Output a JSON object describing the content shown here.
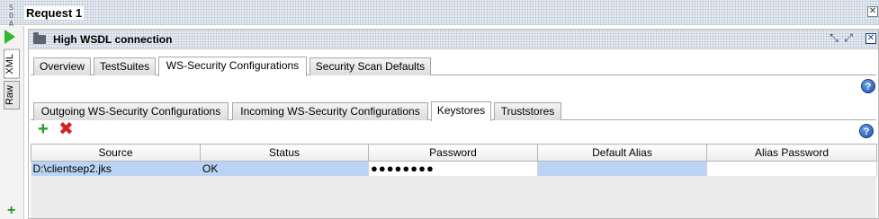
{
  "window": {
    "title": "Request 1",
    "soap_icon_text": "S O\nA P"
  },
  "left_strip": {
    "tabs": [
      {
        "label": "XML"
      },
      {
        "label": "Raw"
      }
    ]
  },
  "panel": {
    "title": "High WSDL connection"
  },
  "top_tabs": [
    {
      "label": "Overview"
    },
    {
      "label": "TestSuites"
    },
    {
      "label": "WS-Security Configurations"
    },
    {
      "label": "Security Scan Defaults"
    }
  ],
  "sub_tabs": [
    {
      "label": "Outgoing WS-Security Configurations"
    },
    {
      "label": "Incoming WS-Security Configurations"
    },
    {
      "label": "Keystores"
    },
    {
      "label": "Truststores"
    }
  ],
  "keystores_table": {
    "columns": [
      "Source",
      "Status",
      "Password",
      "Default Alias",
      "Alias Password"
    ],
    "rows": [
      {
        "source": "D:\\clientsep2.jks",
        "status": "OK",
        "password": "●●●●●●●●",
        "default_alias": "",
        "alias_password": ""
      }
    ]
  },
  "colors": {
    "accent_selection": "#b9d4f5",
    "add_green": "#1f9a1f",
    "remove_red": "#d61f1f",
    "run_green": "#2eb82e"
  },
  "icons": {
    "run": "play-triangle",
    "folder": "folder-icon",
    "add": "plus-icon",
    "remove": "x-icon",
    "help": "question-circle-icon"
  }
}
